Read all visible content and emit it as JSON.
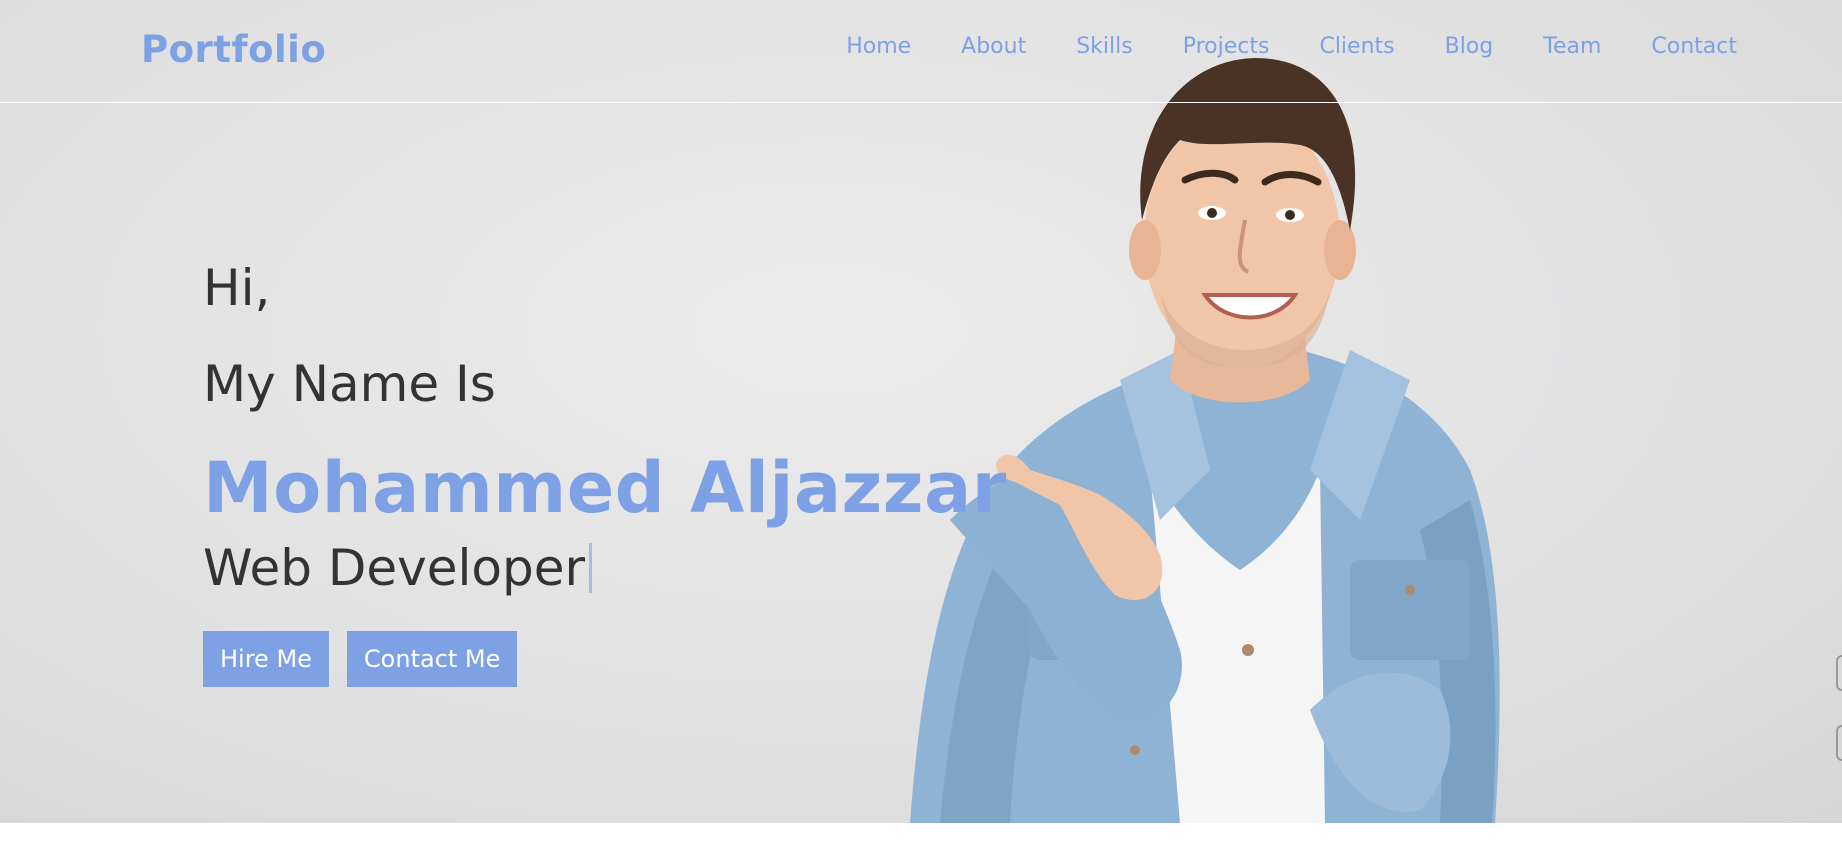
{
  "navbar": {
    "logo": "Portfolio",
    "links": [
      "Home",
      "About",
      "Skills",
      "Projects",
      "Clients",
      "Blog",
      "Team",
      "Contact"
    ]
  },
  "hero": {
    "greeting": "Hi,",
    "intro": "My Name Is",
    "name": "Mohammed Aljazzar",
    "role": "Web Developer",
    "buttons": {
      "hire": "Hire Me",
      "contact": "Contact Me"
    }
  },
  "colors": {
    "accent": "#7ea1e6",
    "text": "#333333",
    "hero_background": "#e2e2e3"
  }
}
